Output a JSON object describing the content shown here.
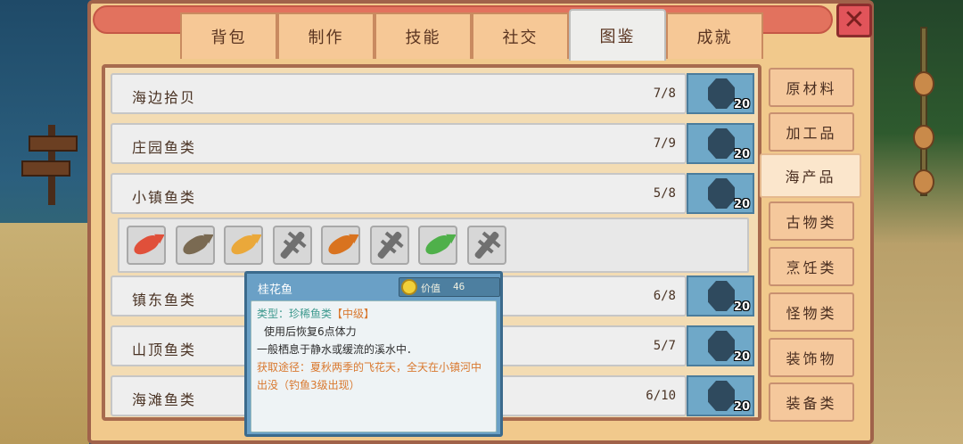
{
  "tabs": [
    {
      "label": "背包"
    },
    {
      "label": "制作"
    },
    {
      "label": "技能"
    },
    {
      "label": "社交"
    },
    {
      "label": "图鉴"
    },
    {
      "label": "成就"
    }
  ],
  "active_tab": "图鉴",
  "close_glyph": "✕",
  "rows": [
    {
      "name": "海边拾贝",
      "count": "7/8",
      "reward_qty": "20"
    },
    {
      "name": "庄园鱼类",
      "count": "7/9",
      "reward_qty": "20"
    },
    {
      "name": "小镇鱼类",
      "count": "5/8",
      "reward_qty": "20"
    },
    {
      "name": "镇东鱼类",
      "count": "6/8",
      "reward_qty": "20"
    },
    {
      "name": "山顶鱼类",
      "count": "5/7",
      "reward_qty": "20"
    },
    {
      "name": "海滩鱼类",
      "count": "6/10",
      "reward_qty": "20"
    }
  ],
  "fish_slots": [
    {
      "icon": "red-fish-icon",
      "color": "#e0503a",
      "locked": false
    },
    {
      "icon": "catfish-icon",
      "color": "#7a6a52",
      "locked": false
    },
    {
      "icon": "yellow-fish-icon",
      "color": "#eaa83a",
      "locked": false
    },
    {
      "icon": "locked-fish-silhouette-icon",
      "color": "#707070",
      "locked": true
    },
    {
      "icon": "orange-fish-icon",
      "color": "#d9731f",
      "locked": false
    },
    {
      "icon": "locked-fish-silhouette-icon",
      "color": "#707070",
      "locked": true
    },
    {
      "icon": "green-fish-icon",
      "color": "#4fb04a",
      "locked": false
    },
    {
      "icon": "locked-fish-silhouette-icon",
      "color": "#707070",
      "locked": true
    }
  ],
  "categories": [
    {
      "label": "原材料"
    },
    {
      "label": "加工品"
    },
    {
      "label": "海产品"
    },
    {
      "label": "古物类"
    },
    {
      "label": "烹饪类"
    },
    {
      "label": "怪物类"
    },
    {
      "label": "装饰物"
    },
    {
      "label": "装备类"
    }
  ],
  "active_category": "海产品",
  "tooltip": {
    "title": "桂花鱼",
    "price_label": "价值",
    "price_value": "46",
    "type_text": "类型：珍稀鱼类",
    "grade_text": "【中级】",
    "effect": "使用后恢复6点体力",
    "habitat": "一般栖息于静水或缓流的溪水中．",
    "source": "获取途径：夏秋两季的飞花天，全天在小镇河中出没（钓鱼3级出现）"
  },
  "colors": {
    "panel_bg": "#f1c98c",
    "accent_red": "#e1545a",
    "reward_blue": "#6fa8c8",
    "grade_orange": "#d9782e",
    "type_teal": "#3f9a8f"
  }
}
